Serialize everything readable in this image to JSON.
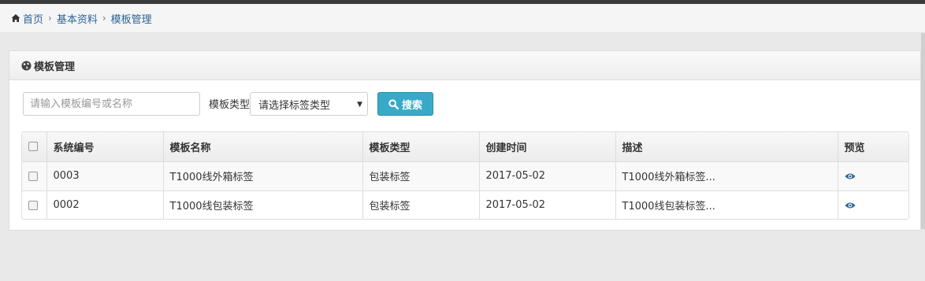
{
  "breadcrumb": {
    "home": "首页",
    "level2": "基本资料",
    "current": "模板管理"
  },
  "panel": {
    "title": "模板管理"
  },
  "search": {
    "placeholder": "请输入模板编号或名称",
    "type_label": "模板类型",
    "type_select_value": "请选择标签类型",
    "button_label": "搜索"
  },
  "table": {
    "headers": [
      "系统编号",
      "模板名称",
      "模板类型",
      "创建时间",
      "描述",
      "预览"
    ],
    "rows": [
      {
        "id": "0003",
        "name": "T1000线外箱标签",
        "type": "包装标签",
        "created": "2017-05-02",
        "desc": "T1000线外箱标签..."
      },
      {
        "id": "0002",
        "name": "T1000线包装标签",
        "type": "包装标签",
        "created": "2017-05-02",
        "desc": "T1000线包装标签..."
      }
    ]
  },
  "icons": {
    "home": "home-icon",
    "panel": "globe-icon",
    "search": "search-icon",
    "preview": "eye-icon"
  },
  "colors": {
    "link": "#2a6496",
    "button": "#39a9c9",
    "preview_icon": "#2a6496"
  }
}
